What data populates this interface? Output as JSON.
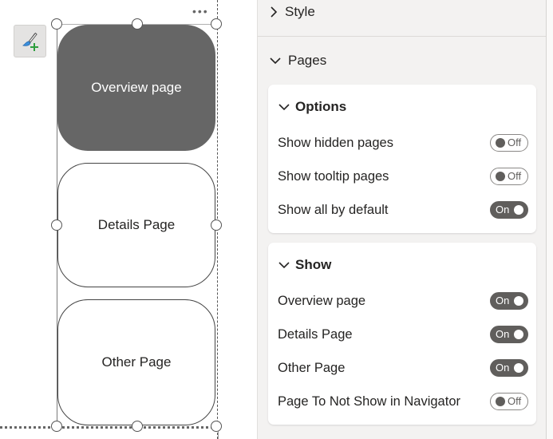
{
  "canvas": {
    "buttons": [
      {
        "label": "Overview page",
        "state": "active"
      },
      {
        "label": "Details Page",
        "state": "inactive"
      },
      {
        "label": "Other Page",
        "state": "inactive"
      }
    ],
    "more_options": "•••",
    "format_painter_icon": "paintbrush-plus-icon"
  },
  "format_pane": {
    "sections": [
      {
        "label": "Style",
        "expanded": false
      },
      {
        "label": "Pages",
        "expanded": true
      }
    ],
    "options_card": {
      "title": "Options",
      "rows": [
        {
          "label": "Show hidden pages",
          "toggle": "Off"
        },
        {
          "label": "Show tooltip pages",
          "toggle": "Off"
        },
        {
          "label": "Show all by default",
          "toggle": "On"
        }
      ]
    },
    "show_card": {
      "title": "Show",
      "rows": [
        {
          "label": "Overview page",
          "toggle": "On"
        },
        {
          "label": "Details Page",
          "toggle": "On"
        },
        {
          "label": "Other Page",
          "toggle": "On"
        },
        {
          "label": "Page To Not Show in Navigator",
          "toggle": "Off"
        }
      ]
    }
  },
  "colors": {
    "active_button": "#666666",
    "toggle_on": "#605e5c",
    "pane_bg": "#f3f2f1"
  }
}
